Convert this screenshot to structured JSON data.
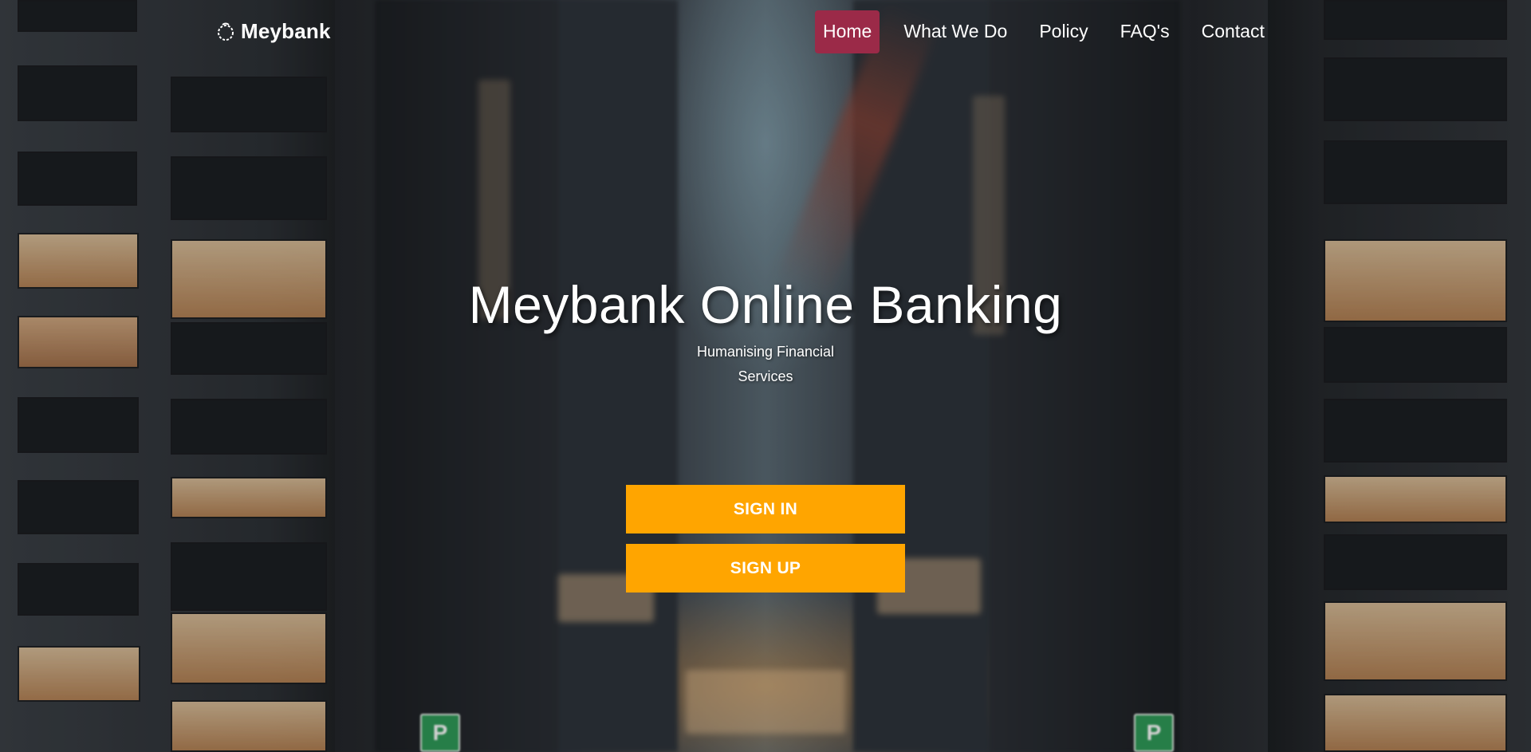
{
  "brand": {
    "name": "Meybank",
    "icon": "wreath-logo-icon"
  },
  "nav": {
    "items": [
      {
        "label": "Home",
        "active": true
      },
      {
        "label": "What We Do",
        "active": false
      },
      {
        "label": "Policy",
        "active": false
      },
      {
        "label": "FAQ's",
        "active": false
      },
      {
        "label": "Contact",
        "active": false
      }
    ]
  },
  "hero": {
    "title": "Meybank Online Banking",
    "subtitle": "Humanising Financial Services"
  },
  "actions": {
    "sign_in": "SIGN IN",
    "sign_up": "SIGN UP"
  },
  "background": {
    "signs": [
      "P",
      "P"
    ]
  },
  "colors": {
    "active_nav": "#9b2a48",
    "cta": "#ffa500"
  }
}
